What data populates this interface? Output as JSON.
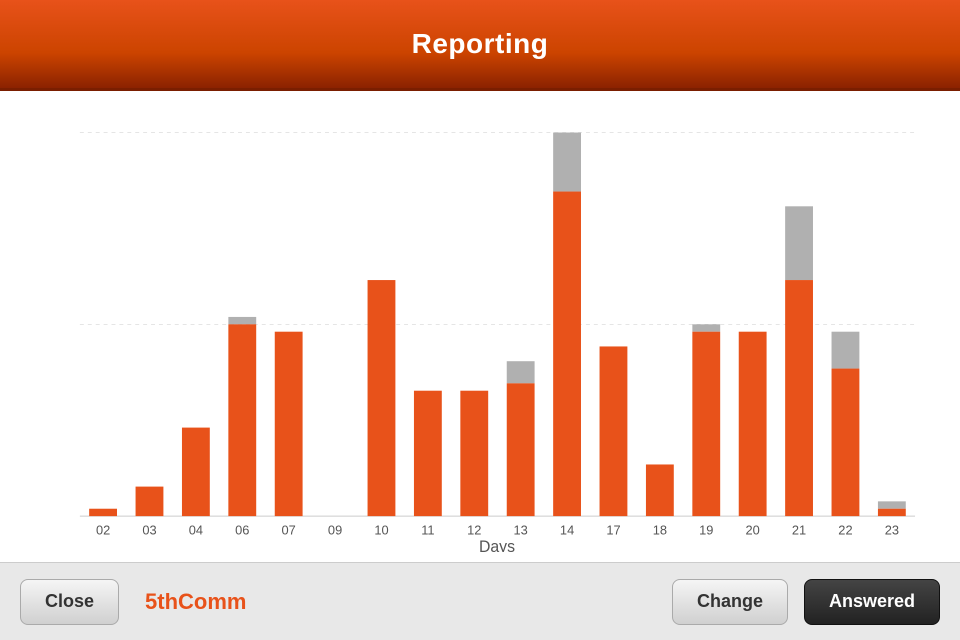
{
  "header": {
    "title": "Reporting"
  },
  "footer": {
    "close_label": "Close",
    "brand_label": "5thComm",
    "change_label": "Change",
    "answered_label": "Answered"
  },
  "chart": {
    "x_axis_label": "Days",
    "y_ticks": [
      0,
      26,
      52
    ],
    "colors": {
      "orange": "#e8521a",
      "gray": "#b0b0b0"
    },
    "bars": [
      {
        "day": "02",
        "orange": 1,
        "gray": 0
      },
      {
        "day": "03",
        "orange": 4,
        "gray": 0
      },
      {
        "day": "04",
        "orange": 12,
        "gray": 0
      },
      {
        "day": "06",
        "orange": 26,
        "gray": 1
      },
      {
        "day": "07",
        "orange": 25,
        "gray": 0
      },
      {
        "day": "09",
        "orange": 0,
        "gray": 0
      },
      {
        "day": "10",
        "orange": 32,
        "gray": 0
      },
      {
        "day": "11",
        "orange": 17,
        "gray": 0
      },
      {
        "day": "12",
        "orange": 17,
        "gray": 0
      },
      {
        "day": "13",
        "orange": 18,
        "gray": 3
      },
      {
        "day": "14",
        "orange": 44,
        "gray": 8
      },
      {
        "day": "17",
        "orange": 23,
        "gray": 0
      },
      {
        "day": "18",
        "orange": 7,
        "gray": 0
      },
      {
        "day": "19",
        "orange": 25,
        "gray": 1
      },
      {
        "day": "20",
        "orange": 25,
        "gray": 0
      },
      {
        "day": "21",
        "orange": 32,
        "gray": 10
      },
      {
        "day": "22",
        "orange": 20,
        "gray": 5
      },
      {
        "day": "23",
        "orange": 1,
        "gray": 1
      }
    ]
  }
}
